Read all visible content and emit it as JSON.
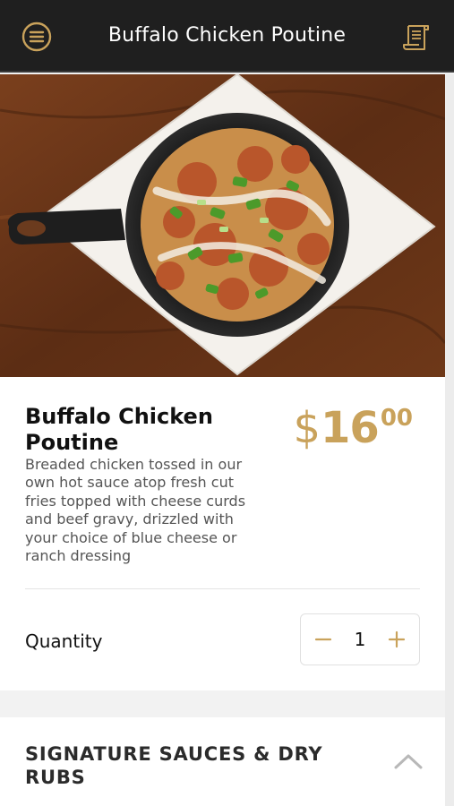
{
  "header": {
    "title": "Buffalo Chicken Poutine",
    "menu_icon": "menu-icon",
    "receipt_icon": "receipt-icon"
  },
  "item": {
    "name": "Buffalo Chicken Poutine",
    "price_currency": "$",
    "price_dollars": "16",
    "price_cents": "00",
    "description": "Breaded chicken tossed in our own hot sauce atop fresh cut fries topped with cheese curds and beef gravy, drizzled with your choice of blue cheese or ranch dressing"
  },
  "quantity": {
    "label": "Quantity",
    "value": "1",
    "decrement_symbol": "−",
    "increment_symbol": "+"
  },
  "section": {
    "title": "SIGNATURE SAUCES & DRY RUBS",
    "chevron_icon": "chevron-up-icon"
  },
  "colors": {
    "accent": "#c9a25b",
    "header_bg": "#1f1f1f"
  }
}
